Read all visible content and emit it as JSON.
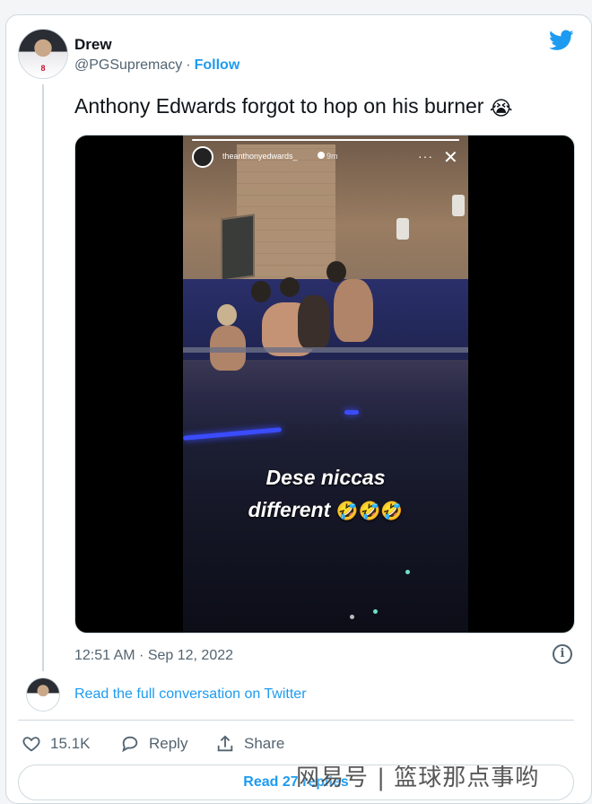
{
  "author": {
    "name": "Drew",
    "handle": "@PGSupremacy",
    "follow_label": "Follow",
    "jersey": "8"
  },
  "tweet": {
    "text": "Anthony Edwards forgot to hop on his burner",
    "emoji": "😭"
  },
  "media": {
    "story_username": "theanthonyedwards_",
    "story_time": "9m",
    "story_progress": 1.0,
    "caption_line1": "Dese niccas",
    "caption_line2": "different",
    "caption_emoji": "🤣🤣🤣"
  },
  "meta": {
    "timestamp": "12:51 AM · Sep 12, 2022",
    "info_icon": "i"
  },
  "conversation": {
    "link_label": "Read the full conversation on Twitter"
  },
  "actions": {
    "like_count": "15.1K",
    "reply_label": "Reply",
    "share_label": "Share"
  },
  "footer": {
    "read_replies_label": "Read 27 replies"
  },
  "watermark": "网易号 | 篮球那点事哟",
  "colors": {
    "accent": "#1d9bf0",
    "muted": "#536471",
    "border": "#cfd9de"
  }
}
